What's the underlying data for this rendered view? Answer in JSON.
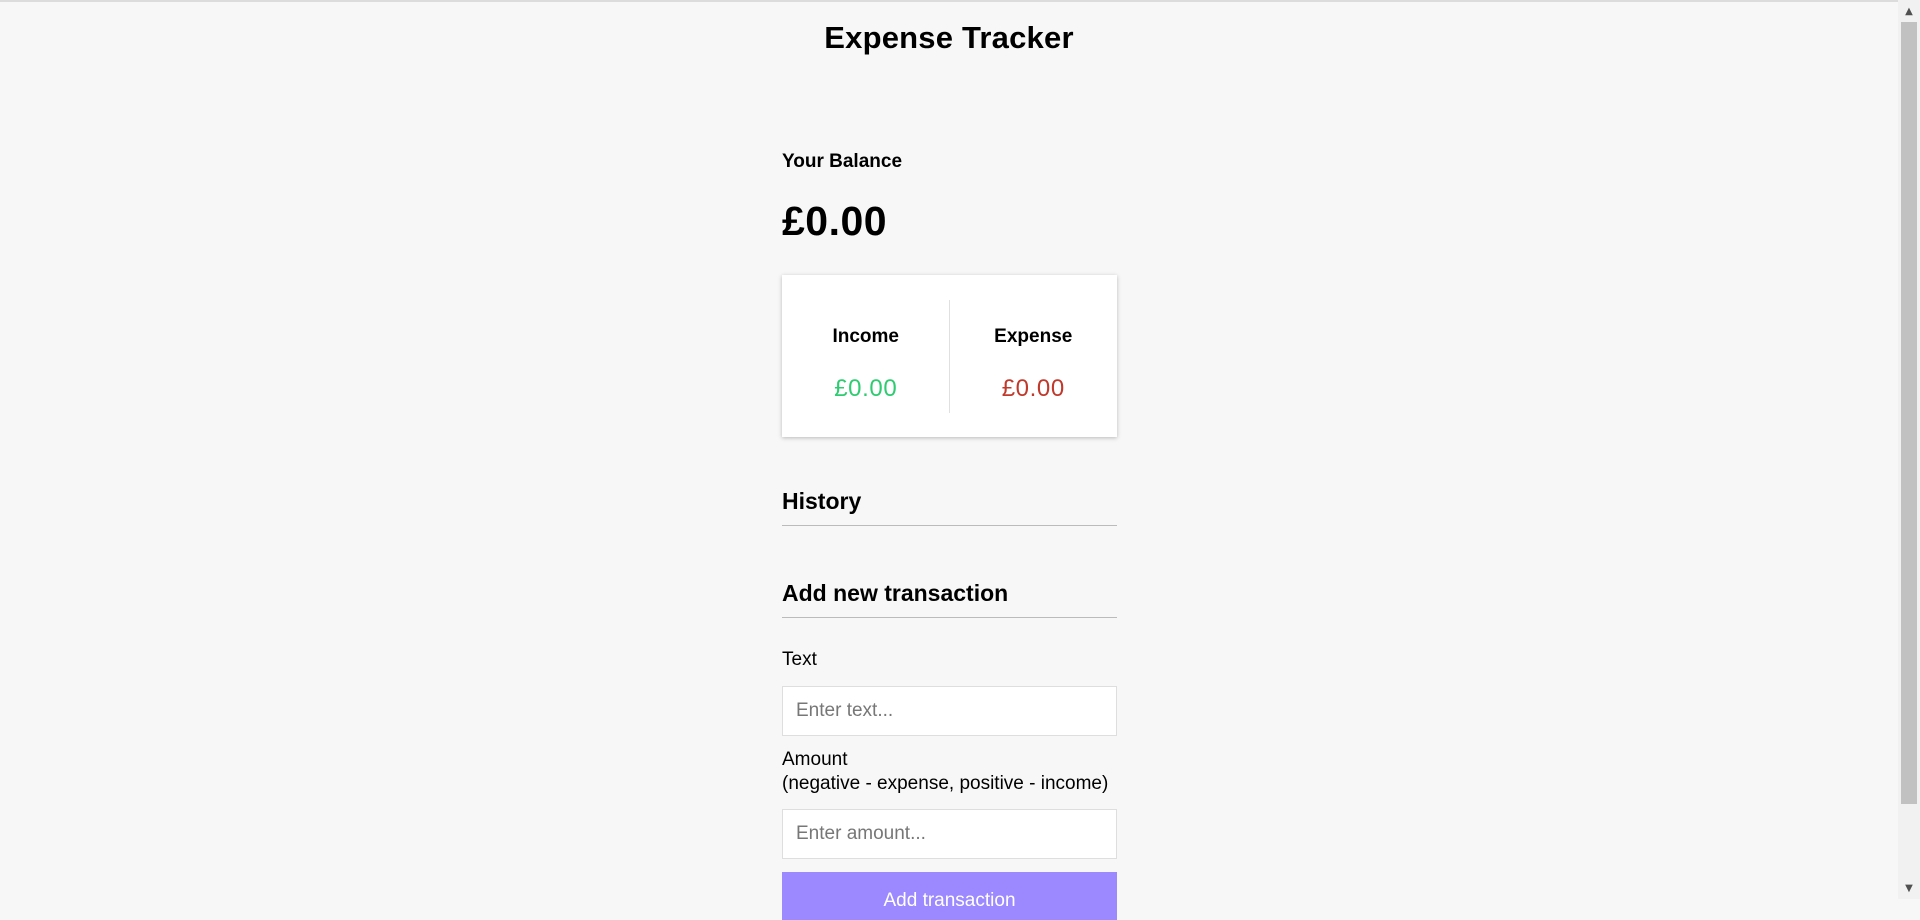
{
  "header": {
    "title": "Expense Tracker"
  },
  "balance": {
    "label": "Your Balance",
    "value": "£0.00"
  },
  "summary": {
    "income_label": "Income",
    "income_value": "£0.00",
    "expense_label": "Expense",
    "expense_value": "£0.00",
    "income_color": "#2ecc71",
    "expense_color": "#c0392b"
  },
  "history": {
    "title": "History"
  },
  "form": {
    "title": "Add new transaction",
    "text_label": "Text",
    "text_placeholder": "Enter text...",
    "amount_label": "Amount",
    "amount_hint": "(negative - expense, positive - income)",
    "amount_placeholder": "Enter amount...",
    "submit_label": "Add transaction",
    "submit_color": "#9c88ff"
  },
  "scrollbar": {
    "up_icon": "triangle-up-icon",
    "down_icon": "triangle-down-icon"
  }
}
